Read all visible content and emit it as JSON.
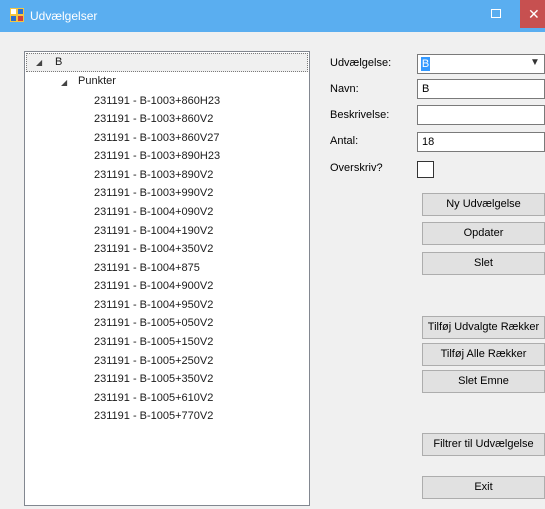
{
  "window": {
    "title": "Udvælgelser",
    "close_glyph": "✕"
  },
  "tree": {
    "root_label": "B",
    "group_label": "Punkter",
    "items": [
      "231191 - B-1003+860H23",
      "231191 - B-1003+860V2",
      "231191 - B-1003+860V27",
      "231191 - B-1003+890H23",
      "231191 - B-1003+890V2",
      "231191 - B-1003+990V2",
      "231191 - B-1004+090V2",
      "231191 - B-1004+190V2",
      "231191 - B-1004+350V2",
      "231191 - B-1004+875",
      "231191 - B-1004+900V2",
      "231191 - B-1004+950V2",
      "231191 - B-1005+050V2",
      "231191 - B-1005+150V2",
      "231191 - B-1005+250V2",
      "231191 - B-1005+350V2",
      "231191 - B-1005+610V2",
      "231191 - B-1005+770V2"
    ]
  },
  "form": {
    "selection_label": "Udvælgelse:",
    "selection_value": "B",
    "name_label": "Navn:",
    "name_value": "B",
    "description_label": "Beskrivelse:",
    "description_value": "",
    "count_label": "Antal:",
    "count_value": "18",
    "overwrite_label": "Overskriv?",
    "overwrite_checked": false
  },
  "buttons": {
    "new": "Ny Udvælgelse",
    "update": "Opdater",
    "delete": "Slet",
    "add_selected": "Tilføj Udvalgte Rækker",
    "add_all": "Tilføj Alle Rækker",
    "delete_item": "Slet Emne",
    "filter": "Filtrer til Udvælgelse",
    "exit": "Exit"
  },
  "colors": {
    "titlebar": "#5aaef0",
    "close_button": "#c75050",
    "selection_highlight": "#3399ff"
  }
}
